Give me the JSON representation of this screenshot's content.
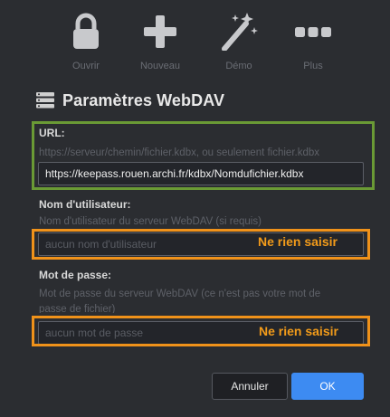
{
  "toolbar": {
    "items": [
      {
        "label": "Ouvrir",
        "icon": "lock-icon"
      },
      {
        "label": "Nouveau",
        "icon": "plus-icon"
      },
      {
        "label": "Démo",
        "icon": "magic-wand-icon"
      },
      {
        "label": "Plus",
        "icon": "more-icon"
      }
    ]
  },
  "dialog": {
    "title": "Paramètres WebDAV",
    "title_icon": "server-icon",
    "url": {
      "label": "URL:",
      "hint": "https://serveur/chemin/fichier.kdbx, ou seulement fichier.kdbx",
      "value": "https://keepass.rouen.archi.fr/kdbx/Nomdufichier.kdbx"
    },
    "username": {
      "label": "Nom d'utilisateur:",
      "hint": "Nom d'utilisateur du serveur WebDAV (si requis)",
      "placeholder": "aucun nom d'utilisateur",
      "value": ""
    },
    "password": {
      "label": "Mot de passe:",
      "hint_line1": "Mot de passe du serveur WebDAV (ce n'est pas votre mot de",
      "hint_line2": "passe de fichier)",
      "placeholder": "aucun mot de passe",
      "value": ""
    },
    "annotations": {
      "username_note": "Ne rien saisir",
      "password_note": "Ne rien saisir"
    },
    "buttons": {
      "cancel": "Annuler",
      "ok": "OK"
    }
  },
  "colors": {
    "background": "#2b2d31",
    "accent": "#3d8bf2",
    "highlight_green": "#6a9a35",
    "highlight_orange": "#f0921a"
  }
}
